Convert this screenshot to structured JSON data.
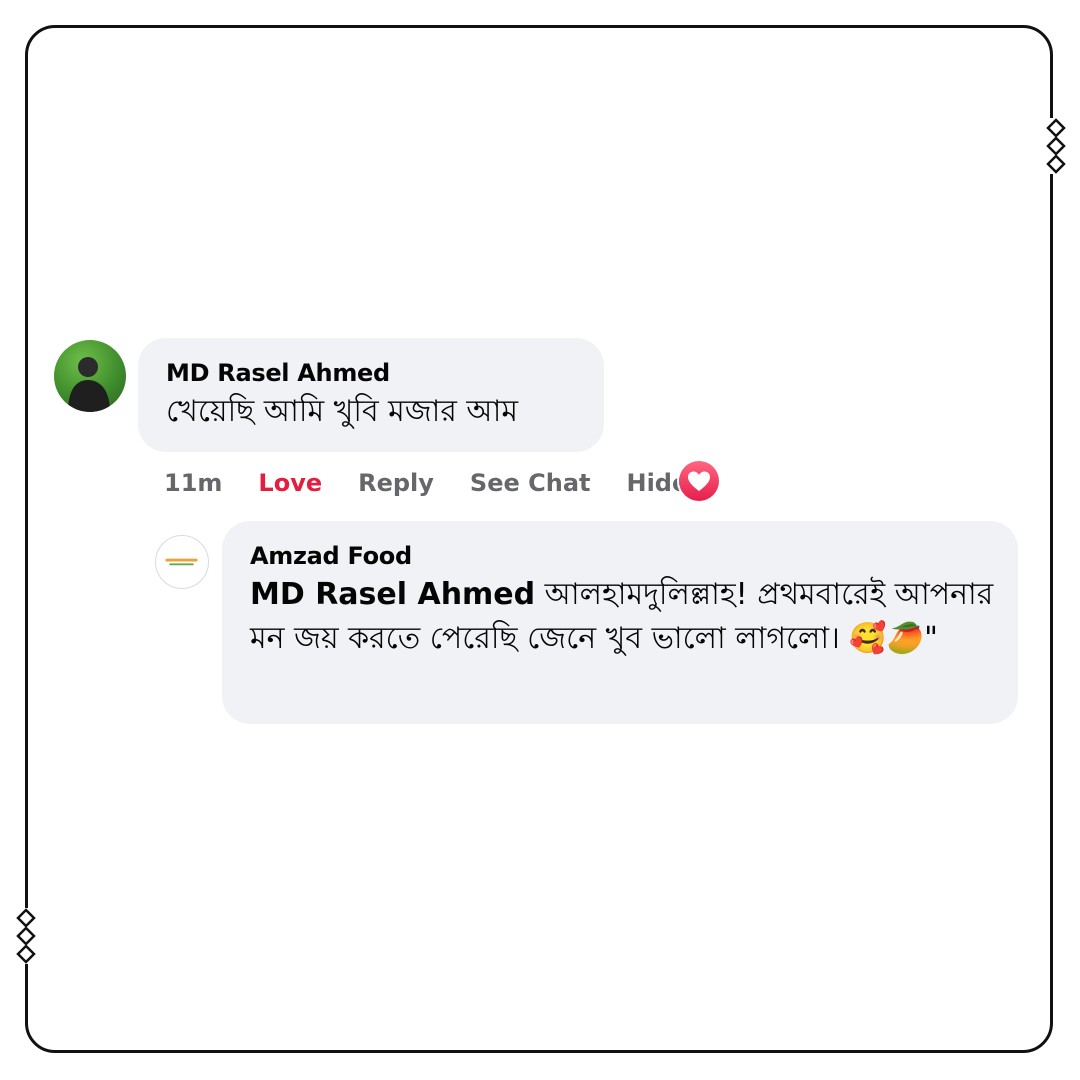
{
  "comment": {
    "author": "MD Rasel Ahmed",
    "text": "খেয়েছি আমি খুবি মজার আম",
    "avatar_icon": "user-avatar",
    "actions": {
      "time": "11m",
      "love": "Love",
      "reply": "Reply",
      "see_chat": "See Chat",
      "hide": "Hide"
    },
    "reaction_icon": "heart-reaction-icon",
    "reaction_color": "#e41e3f"
  },
  "reply": {
    "author": "Amzad Food",
    "mention": "MD Rasel Ahmed",
    "text": " আলহামদুলিল্লাহ! প্রথমবারেই আপনার মন জয় করতে পেরেছি জেনে খুব ভালো লাগলো। ",
    "emoji": "🥰🥭",
    "trailing": "\"",
    "avatar_icon": "brand-logo-avatar"
  },
  "colors": {
    "bubble": "#f0f2f5",
    "frame": "#111111",
    "muted": "#65676b"
  }
}
